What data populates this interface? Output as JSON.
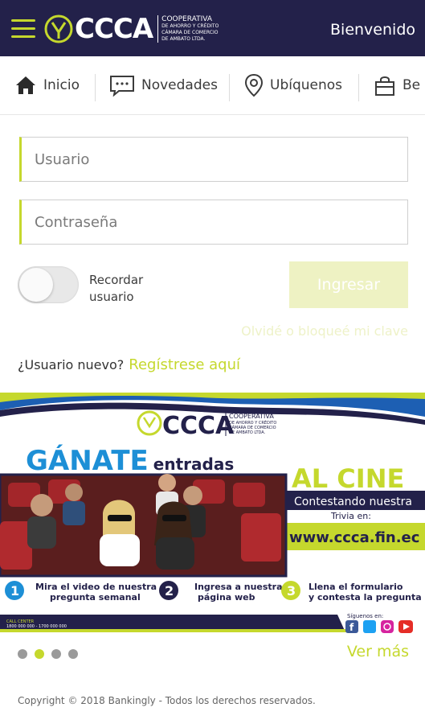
{
  "header": {
    "logo_text": "CCCA",
    "logo_sub": [
      "COOPERATIVA",
      "DE AHORRO Y CRÉDITO",
      "CÁMARA DE COMERCIO",
      "DE AMBATO LTDA."
    ],
    "welcome": "Bienvenido"
  },
  "tabs": [
    {
      "label": "Inicio",
      "icon": "home-icon"
    },
    {
      "label": "Novedades",
      "icon": "chat-icon"
    },
    {
      "label": "Ubíquenos",
      "icon": "map-pin-icon"
    },
    {
      "label": "Be",
      "icon": "bag-icon"
    }
  ],
  "login": {
    "user_placeholder": "Usuario",
    "password_placeholder": "Contraseña",
    "remember_label": "Recordar usuario",
    "submit_label": "Ingresar",
    "forgot_label": "Olvidé o bloqueé mi clave",
    "new_user_label": "¿Usuario nuevo?",
    "register_label": "Regístrese aquí"
  },
  "banner": {
    "logo_text": "CCCA",
    "logo_sub": [
      "COOPERATIVA",
      "DE AHORRO Y CRÉDITO",
      "CÁMARA DE COMERCIO",
      "DE AMBATO LTDA."
    ],
    "headline_1": "GÁNATE",
    "headline_2": "entradas",
    "al_cine": "AL CINE",
    "contestando": "Contestando nuestra",
    "trivia": "Trivia en:",
    "url": "www.ccca.fin.ec",
    "steps": [
      {
        "num": "1",
        "text_1": "Mira el video de nuestra",
        "text_2": "pregunta semanal"
      },
      {
        "num": "2",
        "text_1": "Ingresa a nuestra",
        "text_2": "página web"
      },
      {
        "num": "3",
        "text_1": "Llena el formulario",
        "text_2": "y contesta la pregunta"
      }
    ],
    "callcenter_label": "CALL CENTER",
    "callcenter_numbers": "1800 000 000 - 1700 000 000",
    "siguenos": "Síguenos en:"
  },
  "carousel": {
    "pages": 4,
    "active_index": 1,
    "more_label": "Ver más"
  },
  "footer": {
    "copyright": "Copyright © 2018 Bankingly - Todos los derechos reservados."
  },
  "colors": {
    "navy": "#23214a",
    "lime": "#c5d82d",
    "blue": "#1d5fb3"
  }
}
